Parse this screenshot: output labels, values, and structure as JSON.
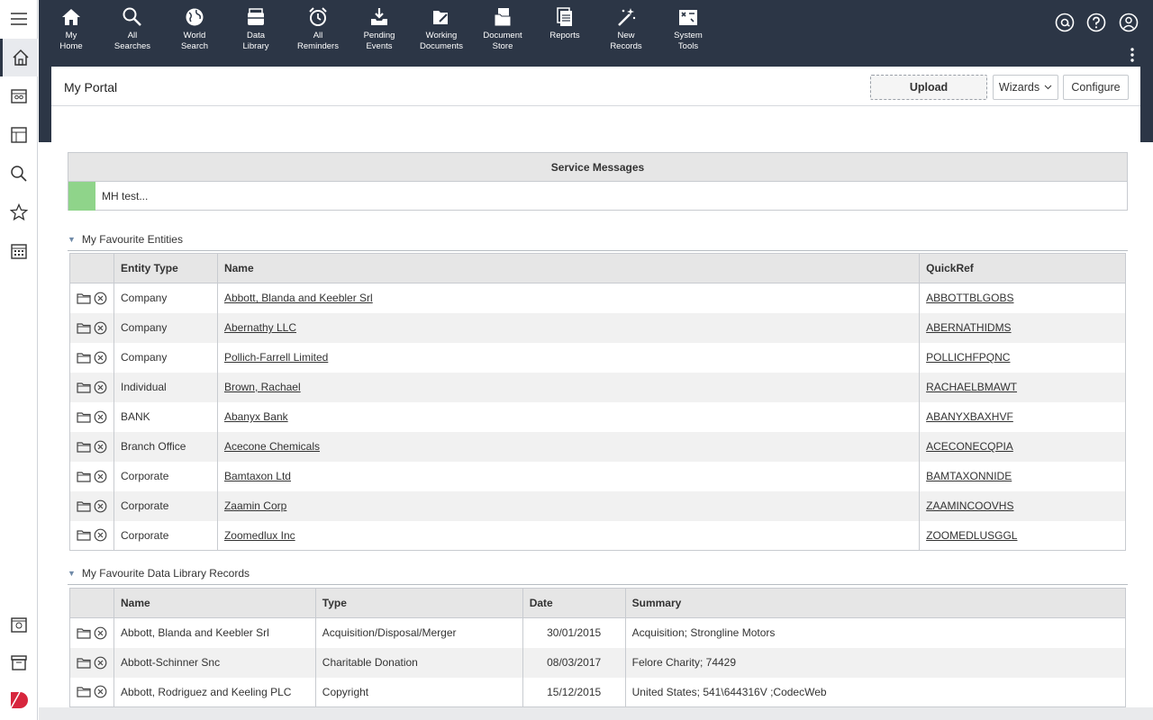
{
  "nav": [
    {
      "label": "My\nHome",
      "icon": "home-icon"
    },
    {
      "label": "All\nSearches",
      "icon": "search-icon"
    },
    {
      "label": "World\nSearch",
      "icon": "globe-icon"
    },
    {
      "label": "Data\nLibrary",
      "icon": "library-icon"
    },
    {
      "label": "All\nReminders",
      "icon": "alarm-clock-icon"
    },
    {
      "label": "Pending\nEvents",
      "icon": "inbox-download-icon"
    },
    {
      "label": "Working\nDocuments",
      "icon": "folder-edit-icon"
    },
    {
      "label": "Document\nStore",
      "icon": "document-store-icon"
    },
    {
      "label": "Reports",
      "icon": "reports-icon"
    },
    {
      "label": "New\nRecords",
      "icon": "magic-wand-icon"
    },
    {
      "label": "System\nTools",
      "icon": "toolbox-icon"
    }
  ],
  "header": {
    "title": "My Portal",
    "upload": "Upload",
    "wizards": "Wizards",
    "configure": "Configure"
  },
  "service": {
    "heading": "Service Messages",
    "message": "MH test...",
    "status_color": "#8fd48a"
  },
  "entities": {
    "section": "My Favourite Entities",
    "columns": [
      "Entity Type",
      "Name",
      "QuickRef"
    ],
    "rows": [
      {
        "type": "Company",
        "name": "Abbott, Blanda and Keebler Srl",
        "ref": "ABBOTTBLGOBS"
      },
      {
        "type": "Company",
        "name": "Abernathy LLC",
        "ref": "ABERNATHIDMS"
      },
      {
        "type": "Company",
        "name": "Pollich-Farrell Limited",
        "ref": "POLLICHFPQNC"
      },
      {
        "type": "Individual",
        "name": "Brown, Rachael",
        "ref": "RACHAELBMAWT"
      },
      {
        "type": "BANK",
        "name": "Abanyx Bank",
        "ref": "ABANYXBAXHVF"
      },
      {
        "type": "Branch Office",
        "name": "Acecone Chemicals",
        "ref": "ACECONECQPIA"
      },
      {
        "type": "Corporate",
        "name": "Bamtaxon Ltd",
        "ref": "BAMTAXONNIDE"
      },
      {
        "type": "Corporate",
        "name": "Zaamin Corp",
        "ref": "ZAAMINCOOVHS"
      },
      {
        "type": "Corporate",
        "name": "Zoomedlux Inc",
        "ref": "ZOOMEDLUSGGL"
      }
    ]
  },
  "library": {
    "section": "My Favourite Data Library Records",
    "columns": [
      "Name",
      "Type",
      "Date",
      "Summary"
    ],
    "rows": [
      {
        "name": "Abbott, Blanda and Keebler Srl",
        "type": "Acquisition/Disposal/Merger",
        "date": "30/01/2015",
        "summary": "Acquisition; Strongline Motors"
      },
      {
        "name": "Abbott-Schinner Snc",
        "type": "Charitable Donation",
        "date": "08/03/2017",
        "summary": "Felore Charity; 74429"
      },
      {
        "name": "Abbott, Rodriguez and Keeling PLC",
        "type": "Copyright",
        "date": "15/12/2015",
        "summary": "United States; 541\\644316V ;CodecWeb"
      }
    ]
  },
  "colors": {
    "topbar": "#2c3646",
    "brand": "#d7263d"
  }
}
